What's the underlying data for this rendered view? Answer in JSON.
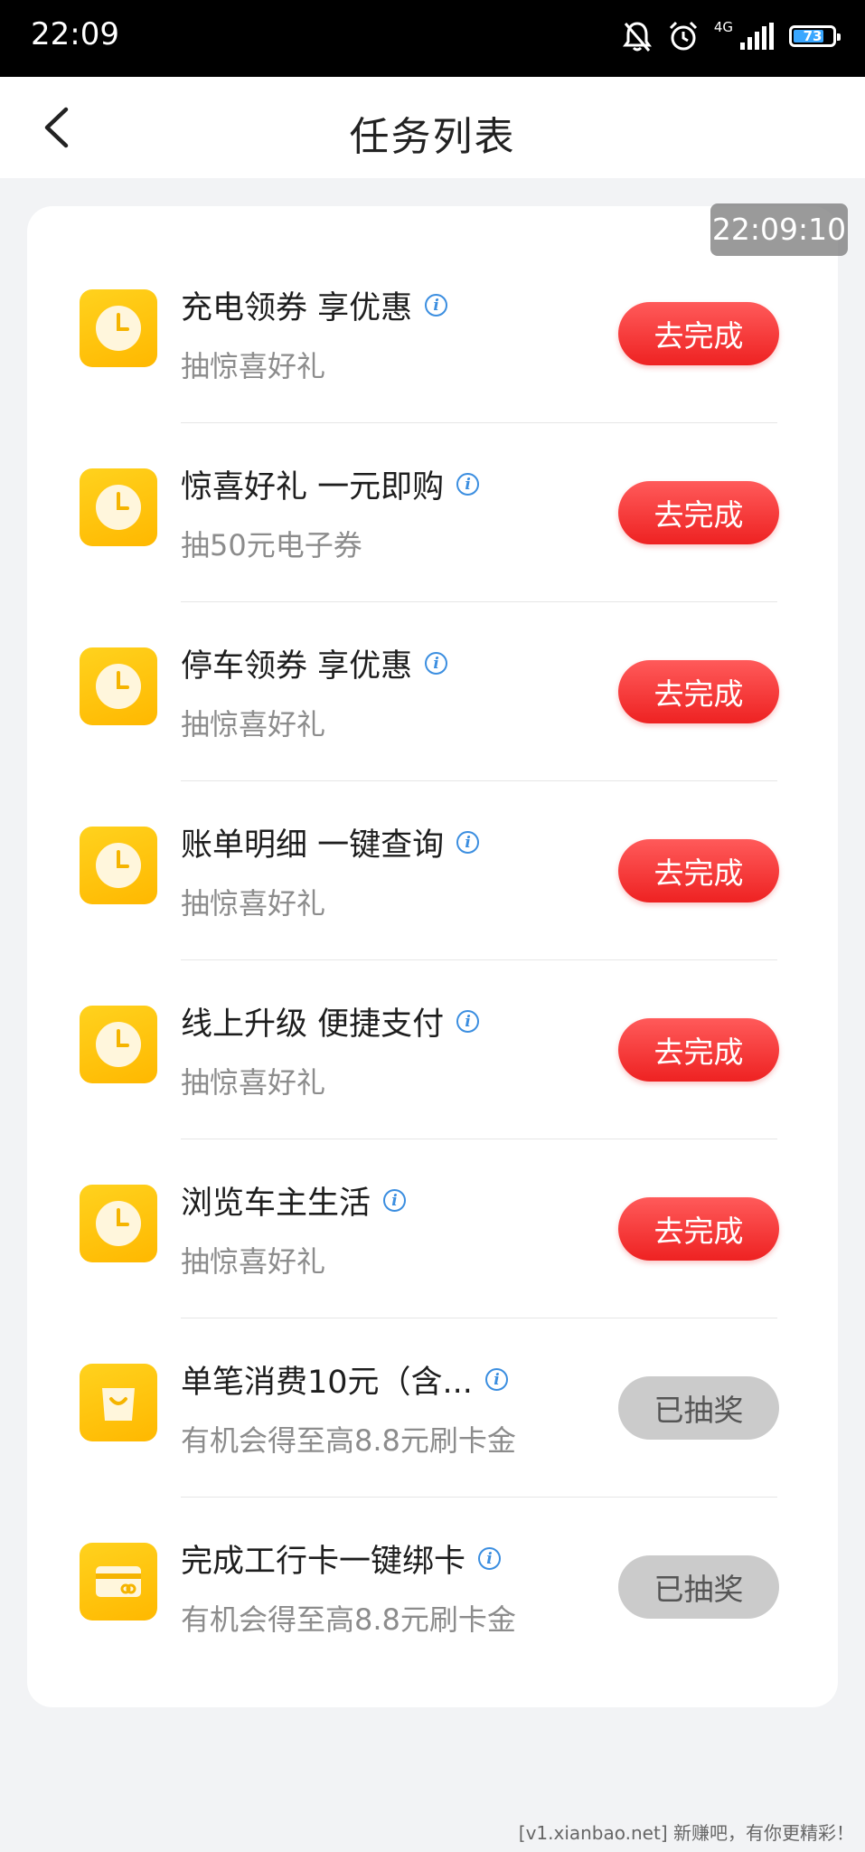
{
  "status_bar": {
    "time": "22:09",
    "network": "4G",
    "battery": "73"
  },
  "nav": {
    "title": "任务列表"
  },
  "timestamp": "22:09:10",
  "tasks": [
    {
      "title": "充电领券 享优惠",
      "subtitle": "抽惊喜好礼",
      "button": "去完成",
      "icon": "clock-icon",
      "state": "todo"
    },
    {
      "title": "惊喜好礼 一元即购",
      "subtitle": "抽50元电子券",
      "button": "去完成",
      "icon": "clock-icon",
      "state": "todo"
    },
    {
      "title": "停车领券 享优惠",
      "subtitle": "抽惊喜好礼",
      "button": "去完成",
      "icon": "clock-icon",
      "state": "todo"
    },
    {
      "title": "账单明细 一键查询",
      "subtitle": "抽惊喜好礼",
      "button": "去完成",
      "icon": "clock-icon",
      "state": "todo"
    },
    {
      "title": "线上升级 便捷支付",
      "subtitle": "抽惊喜好礼",
      "button": "去完成",
      "icon": "clock-icon",
      "state": "todo"
    },
    {
      "title": "浏览车主生活",
      "subtitle": "抽惊喜好礼",
      "button": "去完成",
      "icon": "clock-icon",
      "state": "todo"
    },
    {
      "title": "单笔消费10元（含...",
      "subtitle": "有机会得至高8.8元刷卡金",
      "button": "已抽奖",
      "icon": "shopping-bag-icon",
      "state": "done"
    },
    {
      "title": "完成工行卡一键绑卡",
      "subtitle": "有机会得至高8.8元刷卡金",
      "button": "已抽奖",
      "icon": "bank-card-icon",
      "state": "done"
    }
  ],
  "watermark": "[v1.xianbao.net] 新赚吧，有你更精彩！",
  "colors": {
    "accent_red": "#f03030",
    "icon_yellow": "#ffc20e",
    "info_blue": "#3b8ee0",
    "done_gray": "#cbcbcb"
  }
}
